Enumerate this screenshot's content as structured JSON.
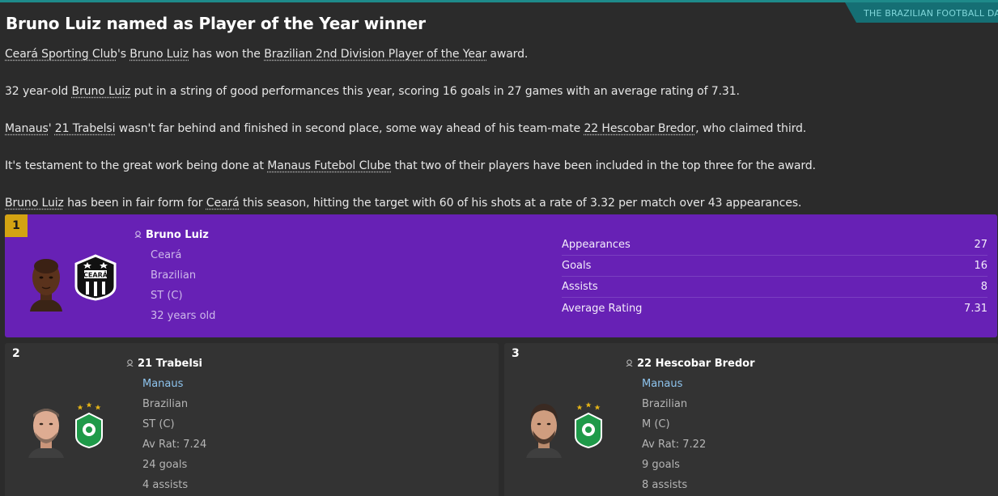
{
  "source_tag": "THE BRAZILIAN FOOTBALL DAILY",
  "headline": "Bruno Luiz named as Player of the Year winner",
  "paragraphs": {
    "p1": {
      "a": "Ceará Sporting Club",
      "b": "'s ",
      "c": "Bruno Luiz",
      "d": " has won the ",
      "e": "Brazilian 2nd Division Player of the Year",
      "f": " award."
    },
    "p2": {
      "a": "32 year-old ",
      "b": "Bruno Luiz",
      "c": " put in a string of good performances this year, scoring 16 goals in 27 games with an average rating of 7.31."
    },
    "p3": {
      "a": "Manaus",
      "b": "' ",
      "c": "21 Trabelsi",
      "d": " wasn't far behind and finished in second place, some way ahead of his team-mate ",
      "e": "22 Hescobar Bredor",
      "f": ", who claimed third."
    },
    "p4": {
      "a": "It's testament to the great work being done at ",
      "b": "Manaus Futebol Clube",
      "c": " that two of their players have been included in the top three for the award."
    },
    "p5": {
      "a": "Bruno Luiz",
      "b": " has been in fair form for ",
      "c": "Ceará",
      "d": " this season, hitting the target with 60 of his shots at a rate of 3.32 per match over 43 appearances."
    }
  },
  "winner": {
    "rank": "1",
    "name": "Bruno Luiz",
    "club": "Ceará",
    "nationality": "Brazilian",
    "position": "ST (C)",
    "age": "32 years old",
    "stats": [
      {
        "label": "Appearances",
        "value": "27"
      },
      {
        "label": "Goals",
        "value": "16"
      },
      {
        "label": "Assists",
        "value": "8"
      },
      {
        "label": "Average Rating",
        "value": "7.31"
      }
    ],
    "crest_text": "CEARÁ"
  },
  "runners_up": [
    {
      "rank": "2",
      "name": "21 Trabelsi",
      "club": "Manaus",
      "nationality": "Brazilian",
      "position": "ST (C)",
      "rating": "Av Rat: 7.24",
      "goals": "24 goals",
      "assists": "4 assists"
    },
    {
      "rank": "3",
      "name": "22 Hescobar Bredor",
      "club": "Manaus",
      "nationality": "Brazilian",
      "position": "M (C)",
      "rating": "Av Rat: 7.22",
      "goals": "9 goals",
      "assists": "8 assists"
    }
  ],
  "colors": {
    "accent_teal": "#1e8a8a",
    "winner_purple": "#6721b5",
    "rank_gold": "#d3a312",
    "link_blue": "#8ec4ee"
  }
}
